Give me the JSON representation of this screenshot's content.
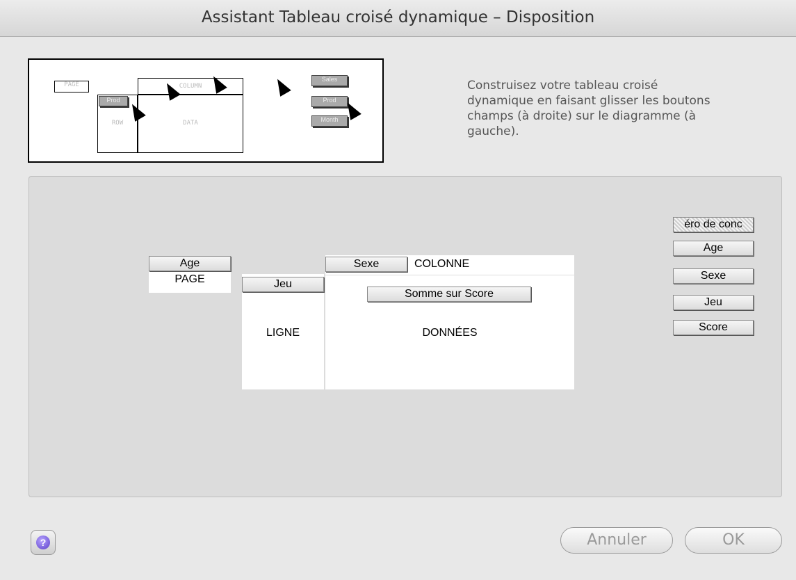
{
  "window": {
    "title": "Assistant Tableau croisé dynamique – Disposition"
  },
  "preview": {
    "zones": {
      "page": "PAGE",
      "column": "COLUMN",
      "row": "ROW",
      "data": "DATA"
    },
    "buttons": {
      "sales": "Sales",
      "prod_area": "Prod",
      "prod_list": "Prod",
      "month": "Month"
    }
  },
  "instructions": "Construisez votre tableau croisé dynamique en faisant glisser les boutons champs (à droite) sur le diagramme (à gauche).",
  "layout": {
    "zones": {
      "page": "PAGE",
      "row": "LIGNE",
      "column": "COLONNE",
      "data": "DONNÉES"
    },
    "placed_fields": {
      "page": "Age",
      "row": "Jeu",
      "column": "Sexe",
      "data": "Somme sur Score"
    },
    "field_list": [
      "éro de conc",
      "Age",
      "Sexe",
      "Jeu",
      "Score"
    ]
  },
  "footer": {
    "help_symbol": "?",
    "cancel": "Annuler",
    "ok": "OK"
  },
  "colors": {
    "accent": "#5a3fc9",
    "panel": "#dcdcdc"
  }
}
